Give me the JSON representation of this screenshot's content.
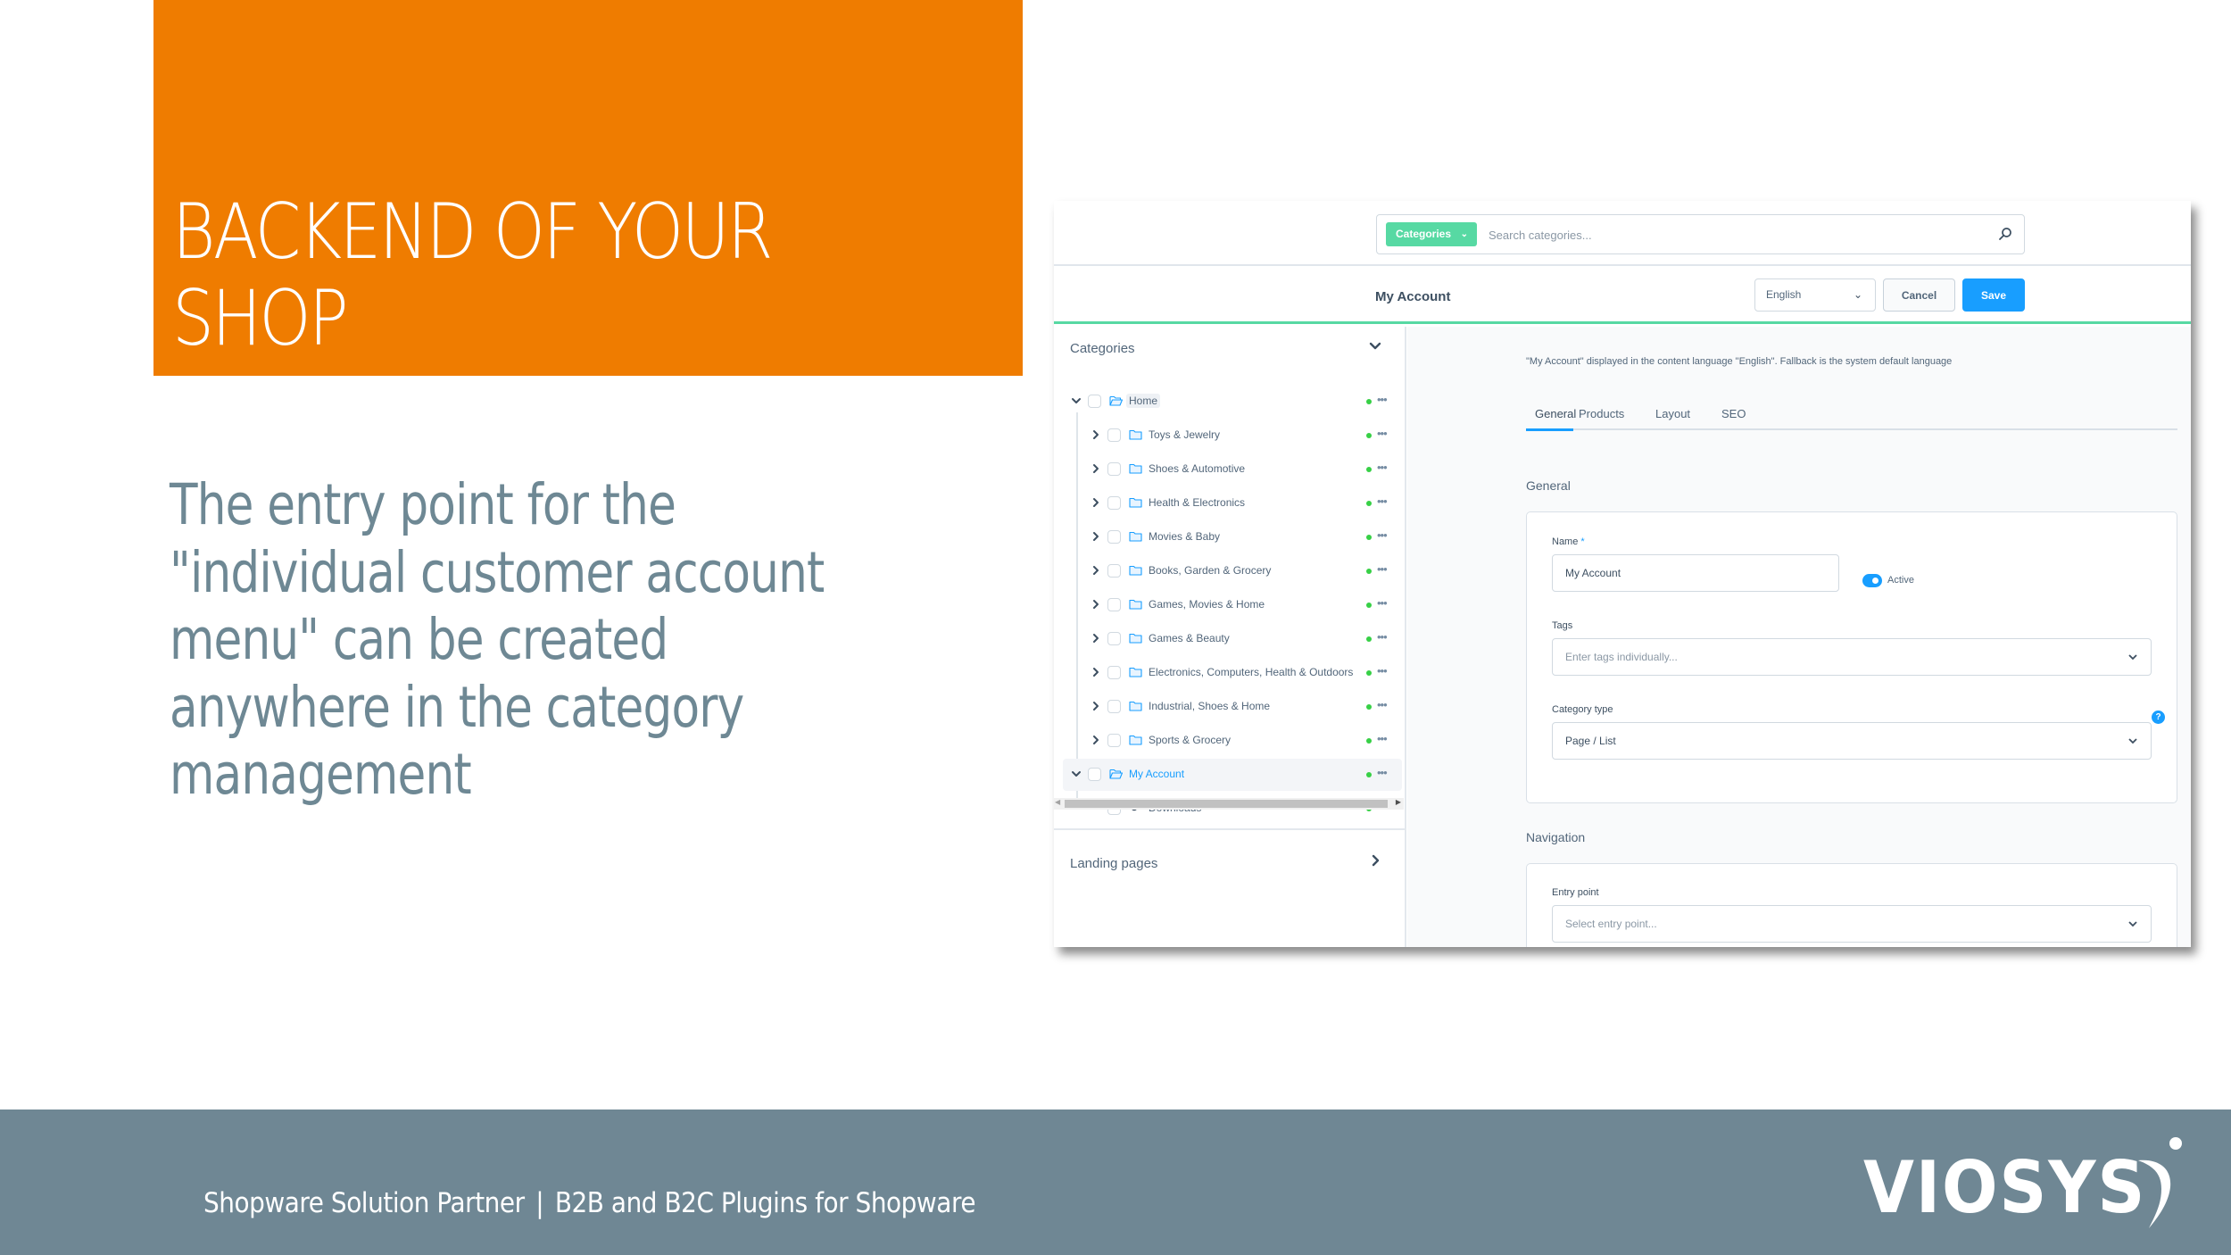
{
  "slide": {
    "title_lines": [
      "BACKEND OF YOUR",
      "SHOP"
    ],
    "body_lines": [
      "The entry point for the",
      "\"individual customer account",
      "menu\" can be created",
      "anywhere in the category",
      "management"
    ],
    "footer_left": "Shopware Solution Partner",
    "footer_sep": "|",
    "footer_right": "B2B and B2C Plugins for Shopware",
    "logo_text": "VIOSYS",
    "colors": {
      "accent_orange": "#ef7c00",
      "footer_gray": "#6f8794",
      "body_text": "#6e8894"
    }
  },
  "app": {
    "search": {
      "type_label": "Categories",
      "placeholder": "Search categories..."
    },
    "header": {
      "title": "My Account",
      "language": "English",
      "cancel_label": "Cancel",
      "save_label": "Save"
    },
    "sidebar": {
      "categories_label": "Categories",
      "landing_pages_label": "Landing pages",
      "tree": [
        {
          "label": "Home",
          "level": 0,
          "expanded": true,
          "icon": "folder-open-icon",
          "status": "active"
        },
        {
          "label": "Toys & Jewelry",
          "level": 1,
          "expanded": false,
          "icon": "folder-icon",
          "status": "active"
        },
        {
          "label": "Shoes & Automotive",
          "level": 1,
          "expanded": false,
          "icon": "folder-icon",
          "status": "active"
        },
        {
          "label": "Health & Electronics",
          "level": 1,
          "expanded": false,
          "icon": "folder-icon",
          "status": "active"
        },
        {
          "label": "Movies & Baby",
          "level": 1,
          "expanded": false,
          "icon": "folder-icon",
          "status": "active"
        },
        {
          "label": "Books, Garden & Grocery",
          "level": 1,
          "expanded": false,
          "icon": "folder-icon",
          "status": "active"
        },
        {
          "label": "Games, Movies & Home",
          "level": 1,
          "expanded": false,
          "icon": "folder-icon",
          "status": "active"
        },
        {
          "label": "Games & Beauty",
          "level": 1,
          "expanded": false,
          "icon": "folder-icon",
          "status": "active"
        },
        {
          "label": "Electronics, Computers, Health & Outdoors",
          "level": 1,
          "expanded": false,
          "icon": "folder-icon",
          "status": "active"
        },
        {
          "label": "Industrial, Shoes & Home",
          "level": 1,
          "expanded": false,
          "icon": "folder-icon",
          "status": "active"
        },
        {
          "label": "Sports & Grocery",
          "level": 1,
          "expanded": false,
          "icon": "folder-icon",
          "status": "active"
        },
        {
          "label": "My Account",
          "level": 0,
          "expanded": true,
          "icon": "folder-open-icon",
          "status": "active",
          "selected": true
        },
        {
          "label": "Downloads",
          "level": 1,
          "expanded": null,
          "icon": "circle-icon",
          "status": "active"
        }
      ]
    },
    "content": {
      "language_info": "\"My Account\" displayed in the content language \"English\". Fallback is the system default language",
      "tabs": [
        "General",
        "Products",
        "Layout",
        "SEO"
      ],
      "active_tab": "General",
      "general_section": {
        "title": "General",
        "name_label": "Name",
        "name_required_mark": "*",
        "name_value": "My Account",
        "active_label": "Active",
        "active_on": true,
        "tags_label": "Tags",
        "tags_placeholder": "Enter tags individually...",
        "category_type_label": "Category type",
        "category_type_value": "Page / List",
        "help_glyph": "?"
      },
      "navigation_section": {
        "title": "Navigation",
        "entry_point_label": "Entry point",
        "entry_point_placeholder": "Select entry point..."
      }
    }
  }
}
